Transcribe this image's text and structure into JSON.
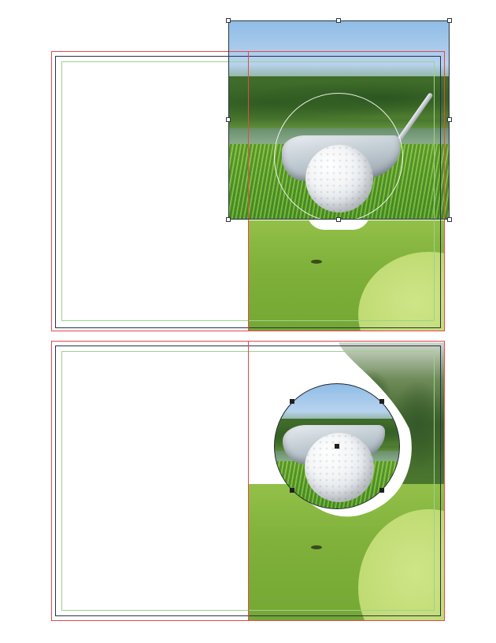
{
  "app": {
    "canvas": "layout-editor-page-view"
  },
  "icons": {
    "handle": "selection-handle-icon",
    "center_point": "center-point-icon"
  },
  "colors": {
    "bleed_guide": "#e8474b",
    "trim_edge": "#2b2f4d",
    "margin_guide": "#9fd08e",
    "selection": "#2d3340"
  },
  "spreads": [
    {
      "image_left": "fairway-photo",
      "image_top": "golf-ball-club-photo",
      "state": "image-frame-selected"
    },
    {
      "image_left": "fairway-photo",
      "image_circle": "golf-ball-circle-photo",
      "state": "circle-frame-selected"
    }
  ]
}
